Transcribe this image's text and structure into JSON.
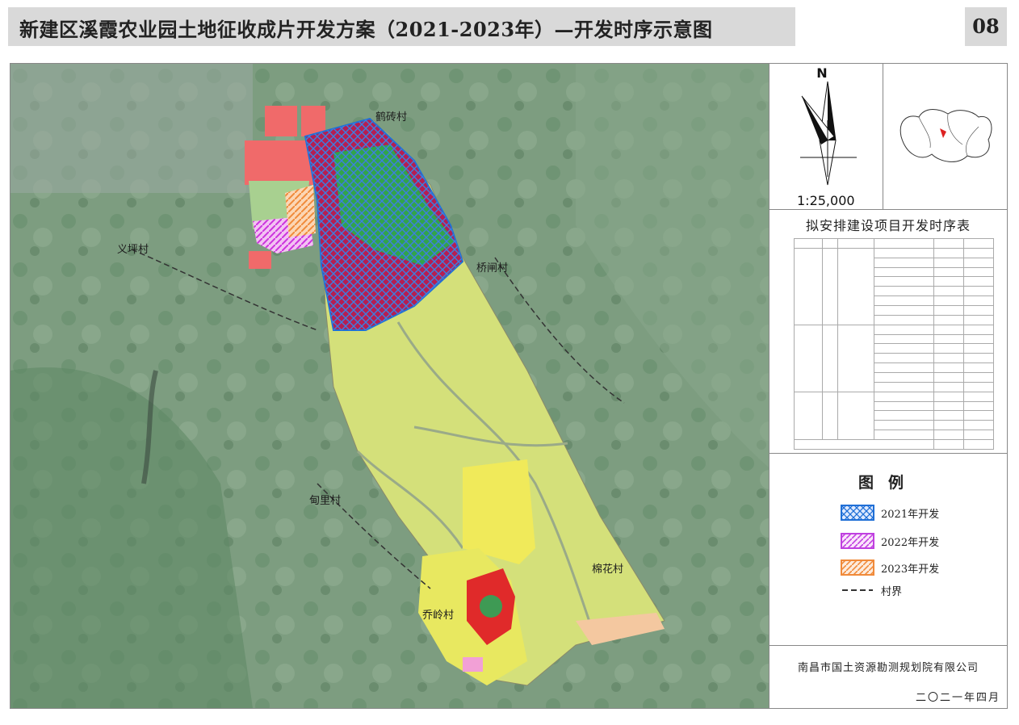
{
  "title": "新建区溪霞农业园土地征收成片开发方案（2021-2023年）—开发时序示意图",
  "page_number": "08",
  "map": {
    "villages": [
      "鹤砖村",
      "桥闸村",
      "义坪村",
      "甸里村",
      "棉花村",
      "乔岭村"
    ],
    "phases": [
      {
        "label": "2021年开发",
        "color": "#1f6fd6"
      },
      {
        "label": "2022年开发",
        "color": "#c040e0"
      },
      {
        "label": "2023年开发",
        "color": "#f08a3a"
      }
    ]
  },
  "north": {
    "letter": "N",
    "scale": "1:25,000"
  },
  "schedule_table": {
    "title": "拟安排建设项目开发时序表"
  },
  "legend": {
    "title": "图例",
    "items": [
      {
        "label": "2021年开发"
      },
      {
        "label": "2022年开发"
      },
      {
        "label": "2023年开发"
      },
      {
        "label": "村界"
      }
    ]
  },
  "footer": {
    "company": "南昌市国土资源勘测规划院有限公司",
    "date": "二〇二一年四月"
  }
}
